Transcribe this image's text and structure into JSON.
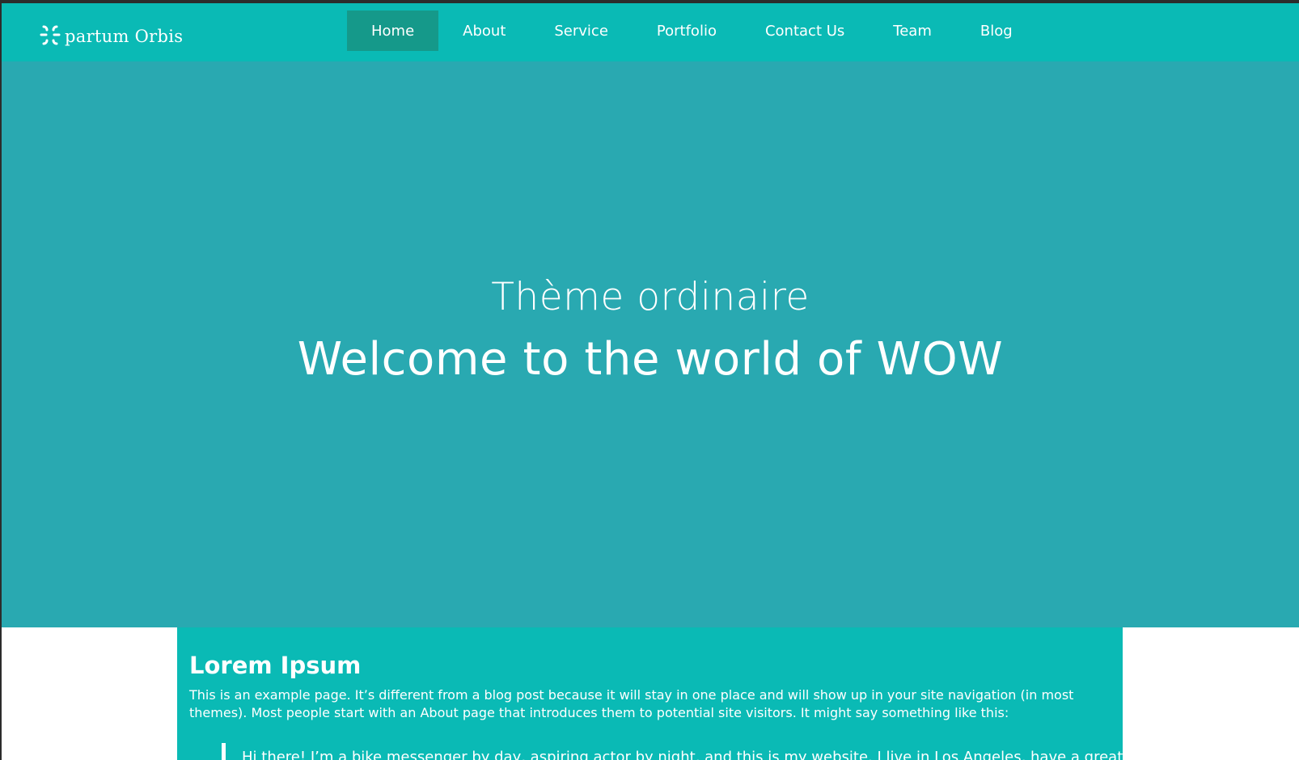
{
  "site": {
    "logo_text": "partum Orbis",
    "logo_icon": "broken-circle-logo-icon"
  },
  "nav": {
    "items": [
      {
        "label": "Home",
        "active": true
      },
      {
        "label": "About"
      },
      {
        "label": "Service"
      },
      {
        "label": "Portfolio"
      },
      {
        "label": "Contact Us"
      },
      {
        "label": "Team"
      },
      {
        "label": "Blog"
      }
    ]
  },
  "hero": {
    "subtitle": "Thème ordinaire",
    "title": "Welcome to the world of WOW"
  },
  "content": {
    "heading": "Lorem Ipsum",
    "paragraph": "This is an example page. It’s different from a blog post because it will stay in one place and will show up in your site navigation (in most themes). Most people start with an About page that introduces them to potential site visitors. It might say something like this:",
    "quote": "Hi there! I’m a bike messenger by day, aspiring actor by night, and this is my website. I live in Los Angeles, have a great dog"
  },
  "colors": {
    "navbar": "#0abab5",
    "nav_active": "#15998a",
    "hero": "#29a9b1",
    "content": "#0abab5",
    "text": "#ffffff"
  }
}
